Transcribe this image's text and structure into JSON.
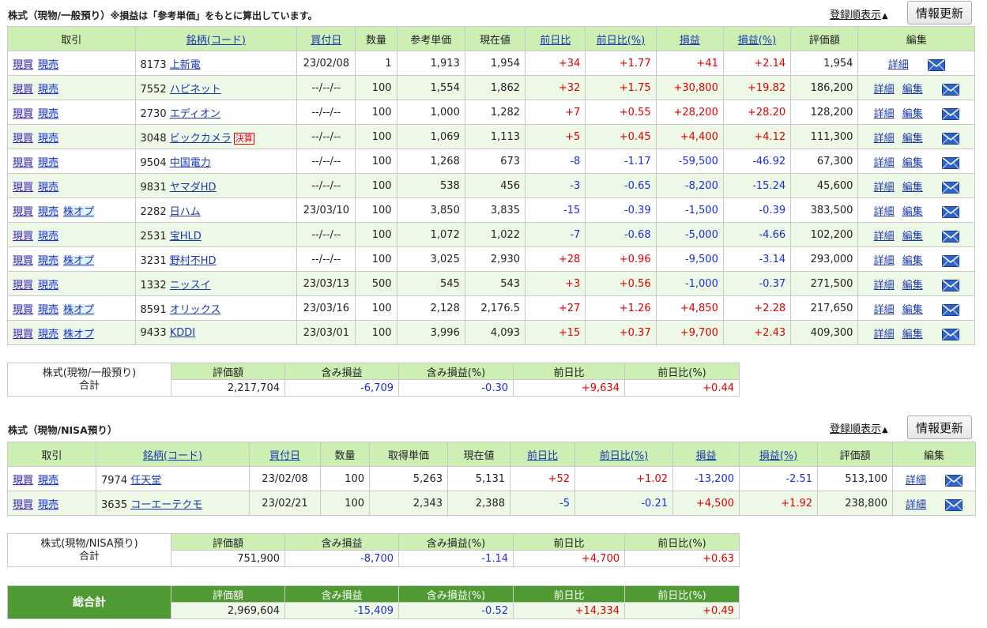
{
  "general": {
    "title": "株式（現物/一般預り）",
    "note": "※損益は「参考単価」をもとに算出しています。",
    "order_link": "登録順表示",
    "refresh_label": "情報更新",
    "headers": [
      "取引",
      "銘柄(コード)",
      "買付日",
      "数量",
      "参考単価",
      "現在値",
      "前日比",
      "前日比(%)",
      "損益",
      "損益(%)",
      "評価額",
      "編集"
    ],
    "link_headers": [
      false,
      true,
      true,
      false,
      false,
      false,
      true,
      true,
      true,
      true,
      false,
      false
    ],
    "buy_label": "現買",
    "sell_label": "現売",
    "opt_label": "株オプ",
    "detail_label": "詳細",
    "edit_label": "編集",
    "earnings_badge": "決算",
    "rows": [
      {
        "code": "8173",
        "name": "上新電",
        "date": "23/02/08",
        "qty": "1",
        "price": "1,913",
        "current": "1,954",
        "change": "+34",
        "change_pct": "+1.77",
        "pl": "+41",
        "pl_pct": "+2.14",
        "value": "1,954",
        "opt": false,
        "badge": false,
        "edit": false
      },
      {
        "code": "7552",
        "name": "ハピネット",
        "date": "--/--/--",
        "qty": "100",
        "price": "1,554",
        "current": "1,862",
        "change": "+32",
        "change_pct": "+1.75",
        "pl": "+30,800",
        "pl_pct": "+19.82",
        "value": "186,200",
        "opt": false,
        "badge": false,
        "edit": true
      },
      {
        "code": "2730",
        "name": "エディオン",
        "date": "--/--/--",
        "qty": "100",
        "price": "1,000",
        "current": "1,282",
        "change": "+7",
        "change_pct": "+0.55",
        "pl": "+28,200",
        "pl_pct": "+28.20",
        "value": "128,200",
        "opt": false,
        "badge": false,
        "edit": true
      },
      {
        "code": "3048",
        "name": "ビックカメラ",
        "date": "--/--/--",
        "qty": "100",
        "price": "1,069",
        "current": "1,113",
        "change": "+5",
        "change_pct": "+0.45",
        "pl": "+4,400",
        "pl_pct": "+4.12",
        "value": "111,300",
        "opt": false,
        "badge": true,
        "edit": true
      },
      {
        "code": "9504",
        "name": "中国電力",
        "date": "--/--/--",
        "qty": "100",
        "price": "1,268",
        "current": "673",
        "change": "-8",
        "change_pct": "-1.17",
        "pl": "-59,500",
        "pl_pct": "-46.92",
        "value": "67,300",
        "opt": false,
        "badge": false,
        "edit": true
      },
      {
        "code": "9831",
        "name": "ヤマダHD",
        "date": "--/--/--",
        "qty": "100",
        "price": "538",
        "current": "456",
        "change": "-3",
        "change_pct": "-0.65",
        "pl": "-8,200",
        "pl_pct": "-15.24",
        "value": "45,600",
        "opt": false,
        "badge": false,
        "edit": true
      },
      {
        "code": "2282",
        "name": "日ハム",
        "date": "23/03/10",
        "qty": "100",
        "price": "3,850",
        "current": "3,835",
        "change": "-15",
        "change_pct": "-0.39",
        "pl": "-1,500",
        "pl_pct": "-0.39",
        "value": "383,500",
        "opt": true,
        "badge": false,
        "edit": true
      },
      {
        "code": "2531",
        "name": "宝HLD",
        "date": "--/--/--",
        "qty": "100",
        "price": "1,072",
        "current": "1,022",
        "change": "-7",
        "change_pct": "-0.68",
        "pl": "-5,000",
        "pl_pct": "-4.66",
        "value": "102,200",
        "opt": false,
        "badge": false,
        "edit": true
      },
      {
        "code": "3231",
        "name": "野村不HD",
        "date": "--/--/--",
        "qty": "100",
        "price": "3,025",
        "current": "2,930",
        "change": "+28",
        "change_pct": "+0.96",
        "pl": "-9,500",
        "pl_pct": "-3.14",
        "value": "293,000",
        "opt": true,
        "badge": false,
        "edit": true
      },
      {
        "code": "1332",
        "name": "ニッスイ",
        "date": "23/03/13",
        "qty": "500",
        "price": "545",
        "current": "543",
        "change": "+3",
        "change_pct": "+0.56",
        "pl": "-1,000",
        "pl_pct": "-0.37",
        "value": "271,500",
        "opt": false,
        "badge": false,
        "edit": true
      },
      {
        "code": "8591",
        "name": "オリックス",
        "date": "23/03/16",
        "qty": "100",
        "price": "2,128",
        "current": "2,176.5",
        "change": "+27",
        "change_pct": "+1.26",
        "pl": "+4,850",
        "pl_pct": "+2.28",
        "value": "217,650",
        "opt": true,
        "badge": false,
        "edit": true
      },
      {
        "code": "9433",
        "name": "KDDI",
        "date": "23/03/01",
        "qty": "100",
        "price": "3,996",
        "current": "4,093",
        "change": "+15",
        "change_pct": "+0.37",
        "pl": "+9,700",
        "pl_pct": "+2.43",
        "value": "409,300",
        "opt": true,
        "badge": false,
        "edit": true
      }
    ],
    "summary": {
      "label_line1": "株式(現物/一般預り)",
      "label_line2": "合計",
      "headers": [
        "評価額",
        "含み損益",
        "含み損益(%)",
        "前日比",
        "前日比(%)"
      ],
      "values": [
        "2,217,704",
        "-6,709",
        "-0.30",
        "+9,634",
        "+0.44"
      ]
    }
  },
  "nisa": {
    "title": "株式（現物/NISA預り）",
    "order_link": "登録順表示",
    "refresh_label": "情報更新",
    "headers": [
      "取引",
      "銘柄(コード)",
      "買付日",
      "数量",
      "取得単価",
      "現在値",
      "前日比",
      "前日比(%)",
      "損益",
      "損益(%)",
      "評価額",
      "編集"
    ],
    "link_headers": [
      false,
      true,
      true,
      false,
      false,
      false,
      true,
      true,
      true,
      true,
      false,
      false
    ],
    "buy_label": "現買",
    "sell_label": "現売",
    "detail_label": "詳細",
    "rows": [
      {
        "code": "7974",
        "name": "任天堂",
        "date": "23/02/08",
        "qty": "100",
        "price": "5,263",
        "current": "5,131",
        "change": "+52",
        "change_pct": "+1.02",
        "pl": "-13,200",
        "pl_pct": "-2.51",
        "value": "513,100"
      },
      {
        "code": "3635",
        "name": "コーエーテクモ",
        "date": "23/02/21",
        "qty": "100",
        "price": "2,343",
        "current": "2,388",
        "change": "-5",
        "change_pct": "-0.21",
        "pl": "+4,500",
        "pl_pct": "+1.92",
        "value": "238,800"
      }
    ],
    "summary": {
      "label_line1": "株式(現物/NISA預り)",
      "label_line2": "合計",
      "headers": [
        "評価額",
        "含み損益",
        "含み損益(%)",
        "前日比",
        "前日比(%)"
      ],
      "values": [
        "751,900",
        "-8,700",
        "-1.14",
        "+4,700",
        "+0.63"
      ]
    }
  },
  "grand_total": {
    "label": "総合計",
    "headers": [
      "評価額",
      "含み損益",
      "含み損益(%)",
      "前日比",
      "前日比(%)"
    ],
    "values": [
      "2,969,604",
      "-15,409",
      "-0.52",
      "+14,334",
      "+0.49"
    ]
  },
  "colors": {
    "header_bg": "#cdefb4",
    "alt_row": "#eef8e6",
    "plus": "#e00000",
    "minus": "#1a2fd8",
    "grand_total_bg": "#4f9a32"
  }
}
